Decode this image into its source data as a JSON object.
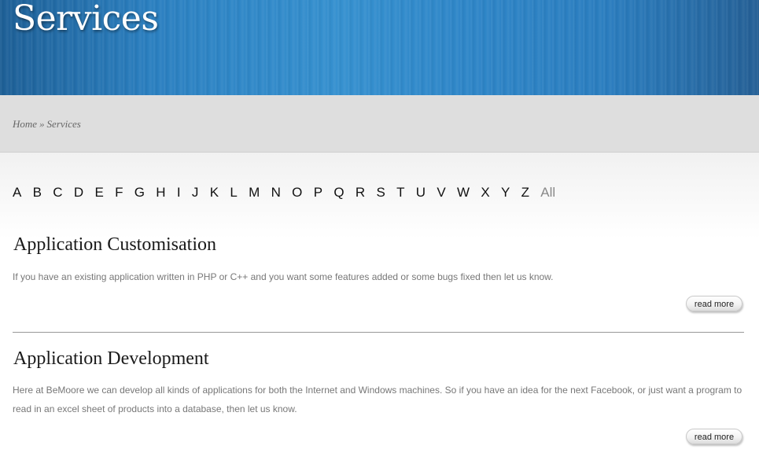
{
  "header": {
    "title": "Services"
  },
  "breadcrumb": {
    "home": "Home",
    "separator": "»",
    "current": "Services"
  },
  "alphabet": [
    "A",
    "B",
    "C",
    "D",
    "E",
    "F",
    "G",
    "H",
    "I",
    "J",
    "K",
    "L",
    "M",
    "N",
    "O",
    "P",
    "Q",
    "R",
    "S",
    "T",
    "U",
    "V",
    "W",
    "X",
    "Y",
    "Z"
  ],
  "alphabet_all": "All",
  "services": [
    {
      "title": "Application Customisation",
      "description": "If you have an existing application written in PHP or C++ and you want some features added or some bugs fixed then let us know.",
      "read_more": "read more"
    },
    {
      "title": "Application Development",
      "description": "Here at BeMoore we can develop all kinds of applications for both the Internet and Windows machines. So if you have an idea for the next Facebook, or just want a program to read in an excel sheet of products into a database, then let us know.",
      "read_more": "read more"
    }
  ],
  "colors": {
    "banner": "#2a7fc0",
    "crumb_bar": "#dedede",
    "link_inactive": "#888888"
  }
}
